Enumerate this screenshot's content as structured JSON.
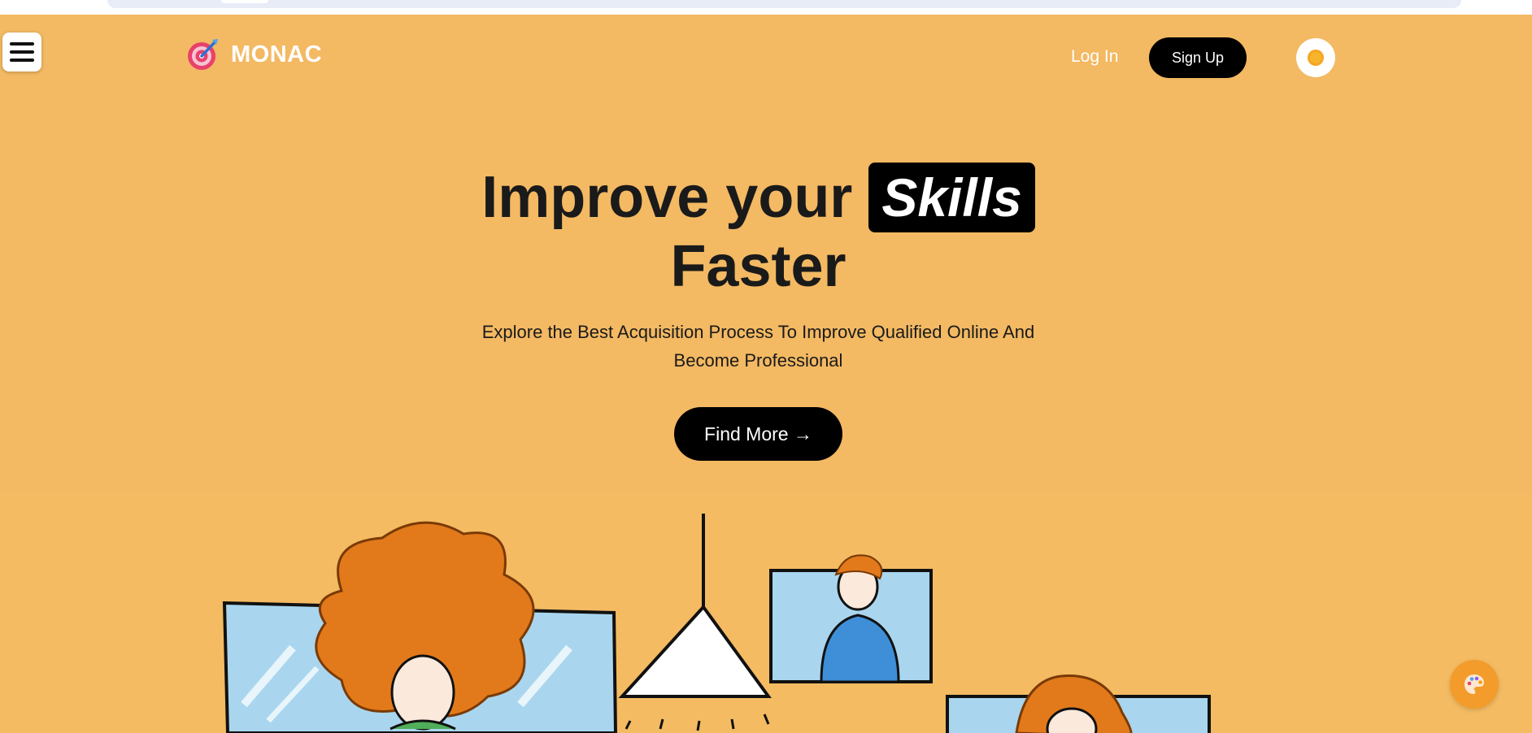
{
  "brand": {
    "name": "MONAC",
    "logo_icon": "target-dart-icon"
  },
  "nav": {
    "login_label": "Log In",
    "signup_label": "Sign Up",
    "theme_icon": "sun-icon",
    "menu_icon": "hamburger-icon"
  },
  "hero": {
    "title_prefix": "Improve your",
    "title_highlight": "Skills",
    "title_suffix": "Faster",
    "subtitle": "Explore the Best Acquisition Process To Improve Qualified Online And Become Professional",
    "cta_label": "Find More →"
  },
  "fab": {
    "icon": "palette-icon"
  },
  "colors": {
    "background": "#f3b963",
    "accent": "#000000",
    "text": "#1a1a1a",
    "fab": "#f39c2b"
  }
}
